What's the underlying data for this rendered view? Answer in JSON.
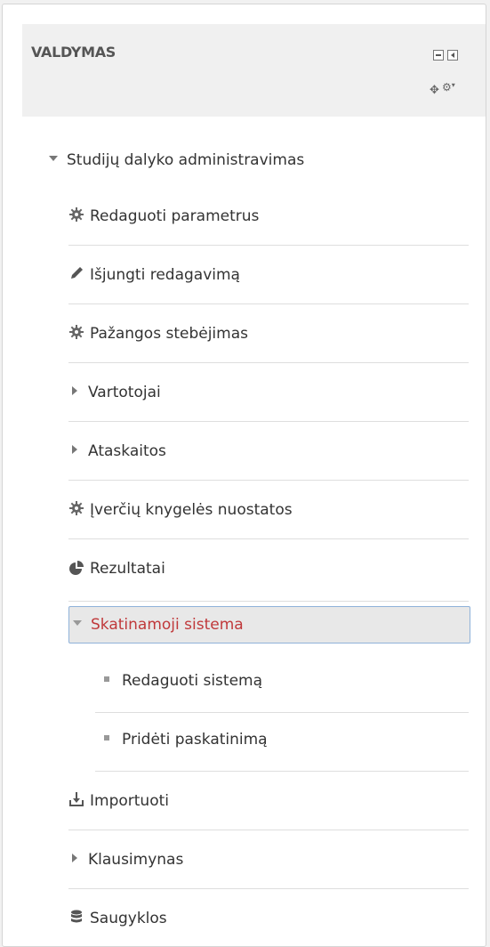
{
  "block": {
    "title": "VALDYMAS",
    "controls": {
      "collapse_icon": "minus-square-icon",
      "dock_icon": "dock-left-icon",
      "move_icon": "move-icon",
      "actions_icon": "gear-icon"
    }
  },
  "tree": {
    "root_label": "Studijų dalyko administravimas",
    "items": [
      {
        "label": "Redaguoti parametrus",
        "icon": "gear-icon"
      },
      {
        "label": "Išjungti redagavimą",
        "icon": "pencil-icon"
      },
      {
        "label": "Pažangos stebėjimas",
        "icon": "gear-icon"
      },
      {
        "label": "Vartotojai",
        "icon": "triangle-right-icon"
      },
      {
        "label": "Ataskaitos",
        "icon": "triangle-right-icon"
      },
      {
        "label": "Įverčių knygelės nuostatos",
        "icon": "gear-icon"
      },
      {
        "label": "Rezultatai",
        "icon": "pie-chart-icon"
      },
      {
        "label": "Skatinamoji sistema",
        "icon": "triangle-down-icon"
      },
      {
        "label": "Importuoti",
        "icon": "import-icon"
      },
      {
        "label": "Klausimynas",
        "icon": "triangle-right-icon"
      },
      {
        "label": "Saugyklos",
        "icon": "database-icon"
      }
    ],
    "subitems": [
      {
        "label": "Redaguoti sistemą"
      },
      {
        "label": "Pridėti paskatinimą"
      }
    ]
  },
  "colors": {
    "active_text": "#c0393b",
    "active_border": "#8fb2d9"
  }
}
